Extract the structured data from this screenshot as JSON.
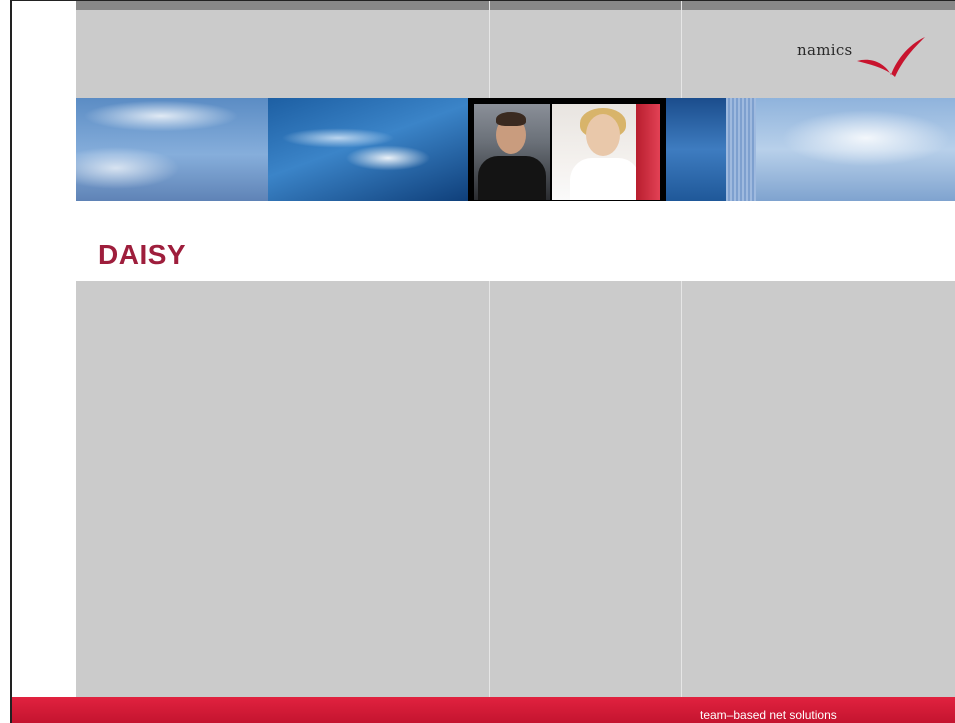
{
  "logo": {
    "text": "namics"
  },
  "slide": {
    "title": "DAISY"
  },
  "footer": {
    "tagline": "team–based net solutions"
  },
  "colors": {
    "accent": "#9e1e3c",
    "footer_red": "#d41a35",
    "background_gray": "#cbcbcb",
    "banner_blue": "#5b8cc4"
  }
}
